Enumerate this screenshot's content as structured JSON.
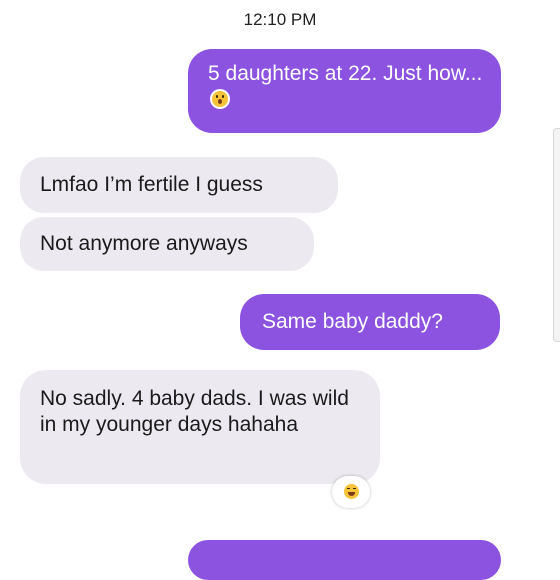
{
  "conversation": {
    "timestamp": "12:10 PM",
    "messages": [
      {
        "direction": "outgoing",
        "text": "5 daughters at 22. Just how...",
        "emoji": "astonished-face"
      },
      {
        "direction": "incoming",
        "text": "Lmfao I’m fertile I guess"
      },
      {
        "direction": "incoming",
        "text": "Not anymore anyways"
      },
      {
        "direction": "outgoing",
        "text": "Same baby daddy?"
      },
      {
        "direction": "incoming",
        "text": "No sadly. 4 baby dads. I was wild in my younger days hahaha",
        "reaction": "laughing-squinting-face"
      },
      {
        "direction": "outgoing",
        "text": ""
      }
    ]
  },
  "colors": {
    "outgoing_bubble": "#8c52e0",
    "incoming_bubble": "#eceaf0",
    "background": "#ffffff"
  }
}
